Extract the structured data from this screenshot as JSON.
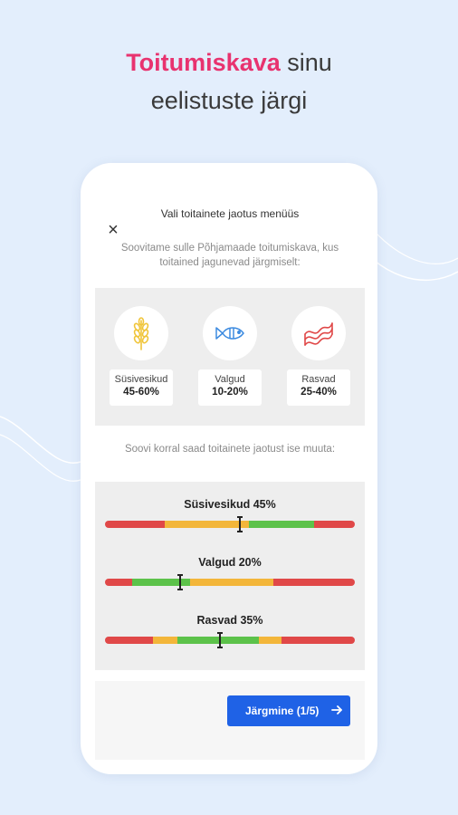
{
  "headline": {
    "accent": "Toitumiskava",
    "rest1": " sinu",
    "line2": "eelistuste järgi"
  },
  "modal": {
    "title": "Vali toitainete jaotus menüüs",
    "intro": "Soovitame sulle Põhjamaade toitumiskava, kus toitained jagunevad järgmiselt:",
    "hint": "Soovi korral saad toitainete jaotust ise muuta:"
  },
  "nutrients": [
    {
      "name": "Süsivesikud",
      "range": "45-60%",
      "icon": "wheat-icon"
    },
    {
      "name": "Valgud",
      "range": "10-20%",
      "icon": "fish-icon"
    },
    {
      "name": "Rasvad",
      "range": "25-40%",
      "icon": "bacon-icon"
    }
  ],
  "sliders": [
    {
      "label": "Süsivesikud 45%",
      "value_percent": 45
    },
    {
      "label": "Valgud 20%",
      "value_percent": 20
    },
    {
      "label": "Rasvad 35%",
      "value_percent": 35
    }
  ],
  "footer": {
    "next_label": "Järgmine (1/5)"
  },
  "colors": {
    "accent": "#e8336f",
    "button": "#1f62e6",
    "red": "#e04848",
    "orange": "#f3b63a",
    "green": "#5cc24a",
    "icon_wheat": "#f0c53a",
    "icon_fish": "#3d8be0",
    "icon_bacon": "#e04848"
  }
}
